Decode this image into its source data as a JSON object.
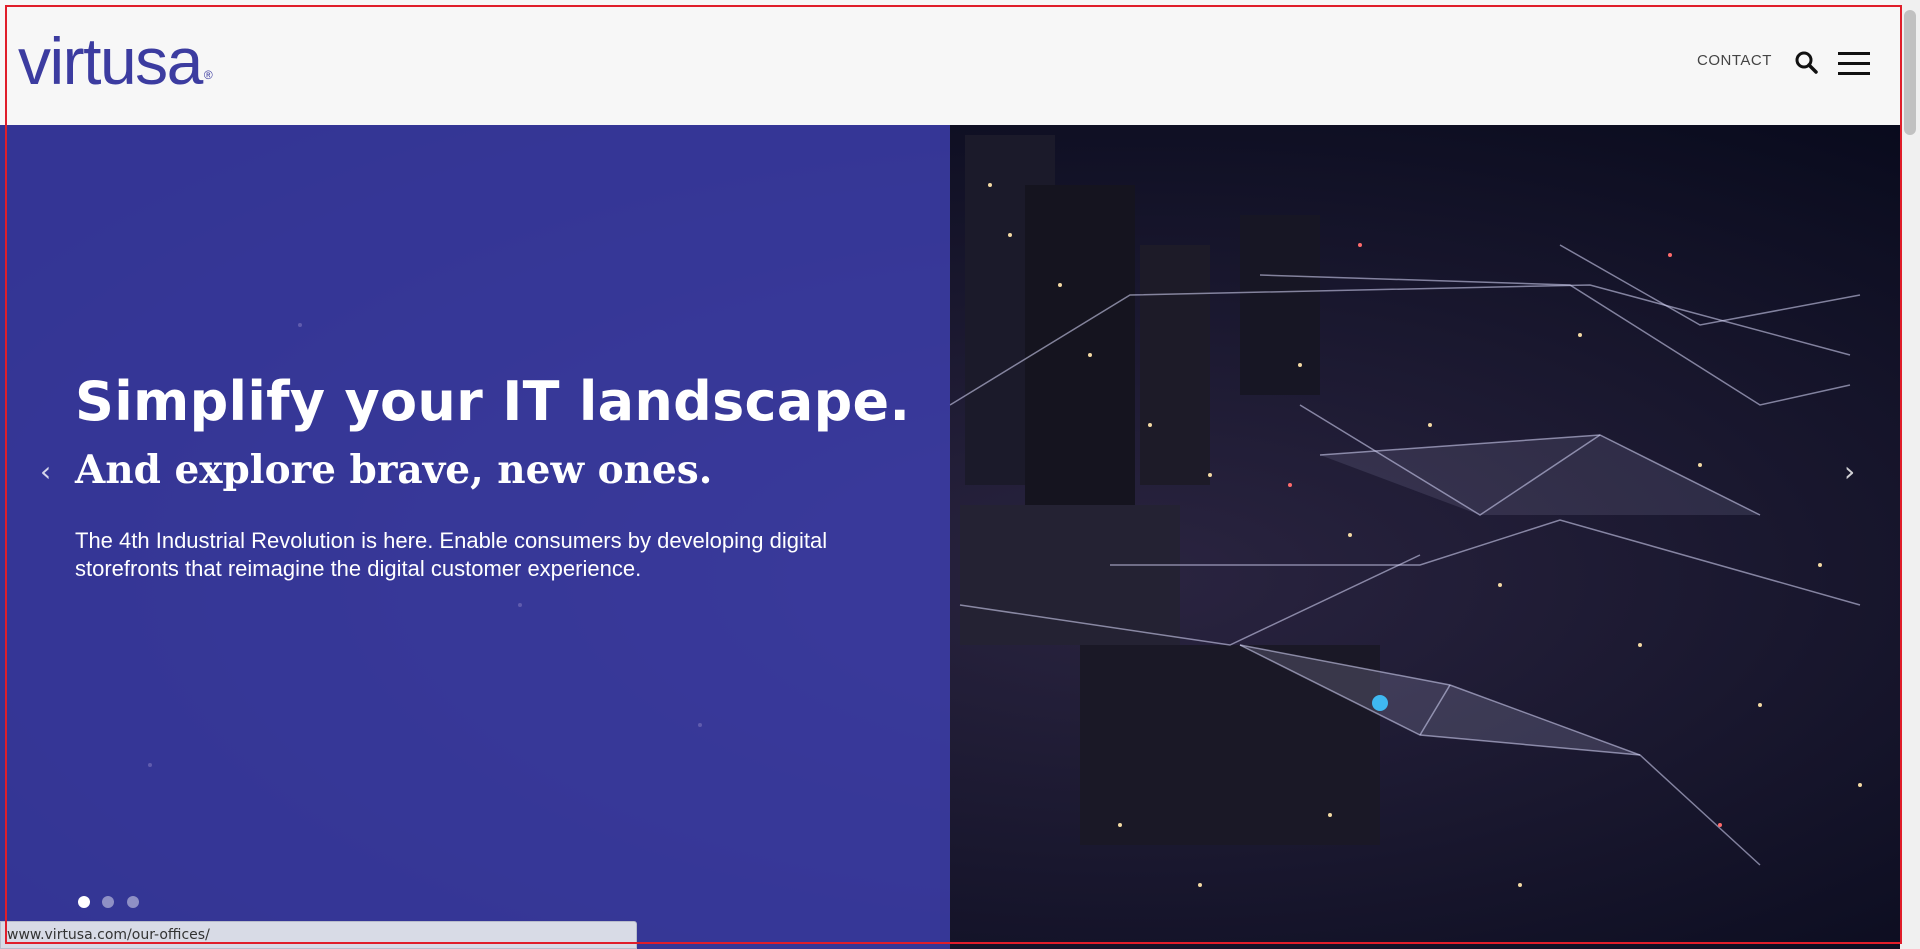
{
  "header": {
    "logo_text": "virtusa",
    "registered_mark": "®",
    "nav_contact": "CONTACT"
  },
  "hero": {
    "title": "Simplify your IT landscape.",
    "subtitle": "And explore brave, new ones.",
    "body": "The 4th Industrial Revolution is here. Enable consumers by developing digital storefronts that reimagine the digital customer experience.",
    "prev_arrow": "‹",
    "next_arrow": "›",
    "slides_count": 3,
    "active_slide": 1
  },
  "status_bar": {
    "url": "www.virtusa.com/our-offices/"
  },
  "colors": {
    "brand_blue": "#3c3ca0",
    "overlay_blue": "#3e40b0",
    "header_bg": "#f7f7f7",
    "frame_red": "#e01e2a"
  },
  "icons": {
    "search": "search-icon",
    "menu": "hamburger-menu-icon"
  }
}
